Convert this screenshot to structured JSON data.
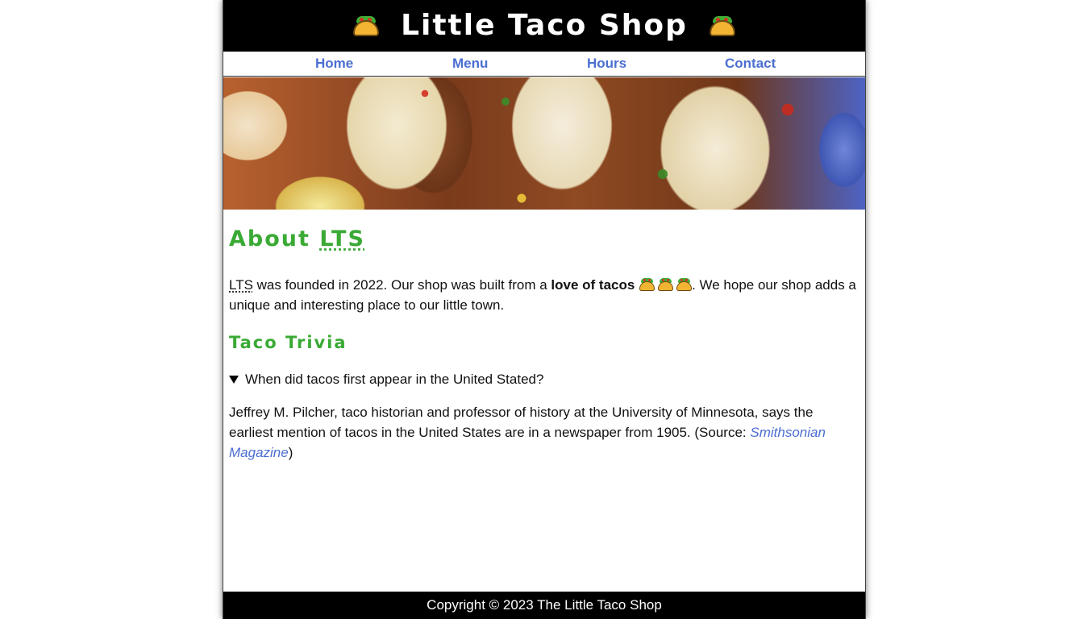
{
  "header": {
    "title": "Little Taco Shop",
    "icon_left": "taco-icon",
    "icon_right": "taco-icon"
  },
  "nav": {
    "items": [
      {
        "label": "Home"
      },
      {
        "label": "Menu"
      },
      {
        "label": "Hours"
      },
      {
        "label": "Contact"
      }
    ]
  },
  "hero": {
    "image": "tacos-photo"
  },
  "about": {
    "heading_prefix": "About ",
    "heading_abbr": "LTS",
    "intro_abbr": "LTS",
    "intro_text_1": " was founded in 2022. Our shop was built from a ",
    "intro_bold": "love of tacos",
    "intro_text_2": ". We hope our shop adds a unique and interesting place to our little town."
  },
  "trivia": {
    "heading": "Taco Trivia",
    "question": "When did tacos first appear in the United Stated?",
    "answer_text": "Jeffrey M. Pilcher, taco historian and professor of history at the University of Minnesota, says the earliest mention of tacos in the United States are in a newspaper from 1905. (Source: ",
    "source_link": "Smithsonian Magazine",
    "answer_close": ")"
  },
  "footer": {
    "text": "Copyright © 2023 The Little Taco Shop"
  },
  "colors": {
    "accent_green": "#3aaa35",
    "link_blue": "#4b6ed1",
    "header_bg": "#000000"
  }
}
